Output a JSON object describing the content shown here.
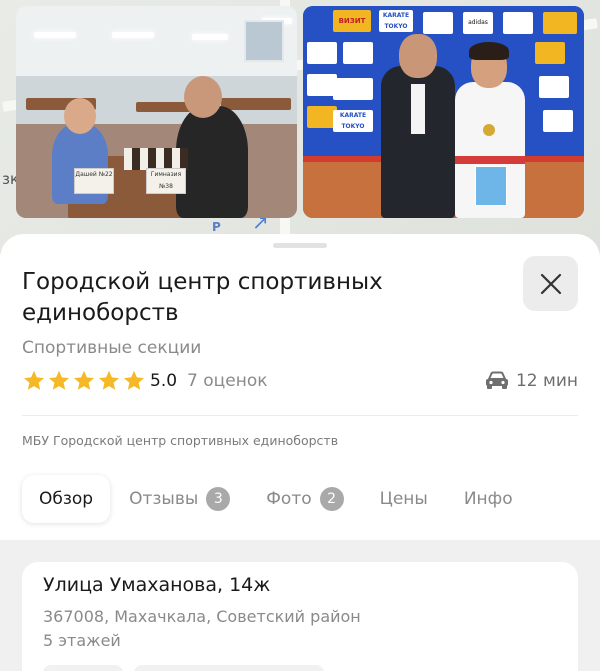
{
  "map": {
    "partial_label": "зк",
    "marker_letter": "Р"
  },
  "photos": {
    "left": {
      "signs": [
        "Дашей №22",
        "Гимназия №38"
      ]
    },
    "right": {
      "banners": [
        "ВИЗИТ",
        "KARATE TOKYO",
        "KARATE TOKYO",
        "adidas"
      ]
    }
  },
  "place": {
    "title": "Городской центр спортивных единоборств",
    "category": "Спортивные секции",
    "rating_value": "5.0",
    "rating_count": "7 оценок",
    "rating_stars": 5,
    "travel_time": "12 мин",
    "travel_icon": "car-icon",
    "org_full_name": "МБУ Городской центр спортивных единоборств"
  },
  "tabs": [
    {
      "label": "Обзор",
      "active": true
    },
    {
      "label": "Отзывы",
      "count": "3"
    },
    {
      "label": "Фото",
      "count": "2"
    },
    {
      "label": "Цены"
    },
    {
      "label": "Инфо"
    }
  ],
  "address": {
    "street": "Улица Умаханова, 14ж",
    "city": "367008, Махачкала, Советский район",
    "floors": "5 этажей"
  },
  "colors": {
    "star": "#f4b925",
    "badge": "#a9a9a9",
    "close_bg": "#ececec"
  }
}
